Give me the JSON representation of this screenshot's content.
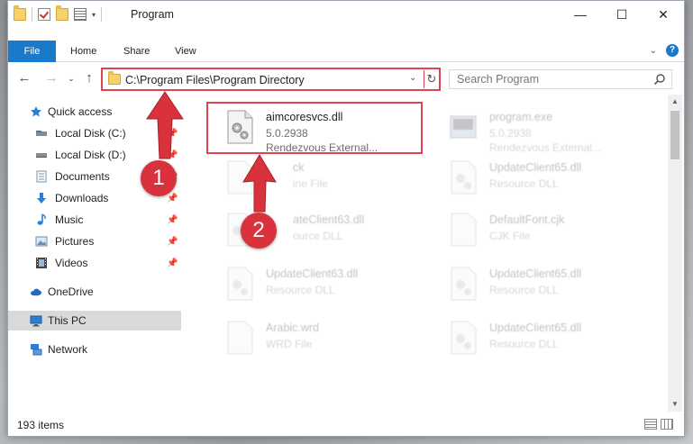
{
  "window": {
    "title": "Program"
  },
  "ribbon": {
    "tabs": [
      "File",
      "Home",
      "Share",
      "View"
    ]
  },
  "address": {
    "path": "C:\\Program Files\\Program Directory"
  },
  "search": {
    "placeholder": "Search Program"
  },
  "sidebar": {
    "items": [
      {
        "label": "Quick access",
        "icon": "star-icon"
      },
      {
        "label": "Local Disk (C:)",
        "icon": "drive-icon",
        "pinned": true
      },
      {
        "label": "Local Disk (D:)",
        "icon": "drive-icon",
        "pinned": true
      },
      {
        "label": "Documents",
        "icon": "documents-icon",
        "pinned": true
      },
      {
        "label": "Downloads",
        "icon": "downloads-icon",
        "pinned": true
      },
      {
        "label": "Music",
        "icon": "music-icon",
        "pinned": true
      },
      {
        "label": "Pictures",
        "icon": "pictures-icon",
        "pinned": true
      },
      {
        "label": "Videos",
        "icon": "videos-icon",
        "pinned": true
      },
      {
        "label": "OneDrive",
        "icon": "onedrive-icon"
      },
      {
        "label": "This PC",
        "icon": "this-pc-icon",
        "selected": true
      },
      {
        "label": "Network",
        "icon": "network-icon"
      }
    ]
  },
  "files": {
    "highlighted": {
      "name": "aimcoresvcs.dll",
      "version": "5.0.2938",
      "description": "Rendezvous External..."
    },
    "faded": [
      {
        "name": "program.exe",
        "line2": "5.0.2938",
        "line3": "Rendezvous External..."
      },
      {
        "name": "ck",
        "line2": "ine File"
      },
      {
        "name": "UpdateClient65.dll",
        "line2": "Resource DLL"
      },
      {
        "name": "ateClient63.dll",
        "line2": "ource DLL"
      },
      {
        "name": "DefaultFont.cjk",
        "line2": "CJK File"
      },
      {
        "name": "UpdateClient63.dll",
        "line2": "Resource DLL"
      },
      {
        "name": "UpdateClient65.dll",
        "line2": "Resource DLL"
      },
      {
        "name": "Arabic.wrd",
        "line2": "WRD File"
      },
      {
        "name": "UpdateClient65.dll",
        "line2": "Resource DLL"
      }
    ]
  },
  "status": {
    "item_count": "193 items"
  },
  "annotations": {
    "step1": "1",
    "step2": "2",
    "color": "#d9323c"
  }
}
